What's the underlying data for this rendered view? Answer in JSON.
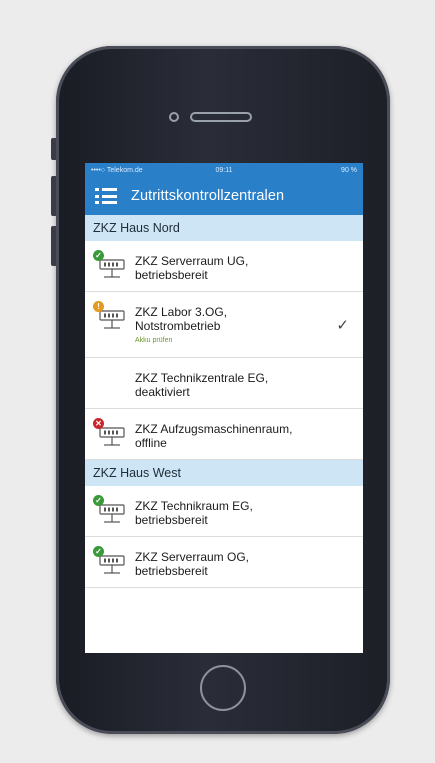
{
  "status_bar": {
    "carrier": "••••○ Telekom.de",
    "time": "09:11",
    "battery": "90 %"
  },
  "header": {
    "title": "Zutrittskontrollzentralen"
  },
  "colors": {
    "accent": "#2a7fc9",
    "section_bg": "#cde5f4",
    "ok": "#3a9a3a",
    "warning": "#e39a1e",
    "error": "#c8262b",
    "hint": "#6a9a2a"
  },
  "sections": [
    {
      "title": "ZKZ Haus Nord",
      "items": [
        {
          "line1": "ZKZ Serverraum UG,",
          "line2": "betriebsbereit",
          "status": "ok",
          "status_icon": "check-badge-icon",
          "hint": "",
          "selected": false
        },
        {
          "line1": "ZKZ Labor 3.OG,",
          "line2": "Notstrombetrieb",
          "status": "warning",
          "status_icon": "warning-badge-icon",
          "hint": "Akku prüfen",
          "selected": true,
          "check_mark": "✓"
        },
        {
          "line1": "ZKZ Technikzentrale EG,",
          "line2": "deaktiviert",
          "status": "none",
          "status_icon": "",
          "hint": "",
          "selected": false
        },
        {
          "line1": "ZKZ Aufzugsmaschinenraum,",
          "line2": "offline",
          "status": "error",
          "status_icon": "error-badge-icon",
          "hint": "",
          "selected": false
        }
      ]
    },
    {
      "title": "ZKZ Haus West",
      "items": [
        {
          "line1": "ZKZ Technikraum EG,",
          "line2": "betriebsbereit",
          "status": "ok",
          "status_icon": "check-badge-icon",
          "hint": "",
          "selected": false
        },
        {
          "line1": "ZKZ Serverraum OG,",
          "line2": "betriebsbereit",
          "status": "ok",
          "status_icon": "check-badge-icon",
          "hint": "",
          "selected": false
        }
      ]
    }
  ]
}
